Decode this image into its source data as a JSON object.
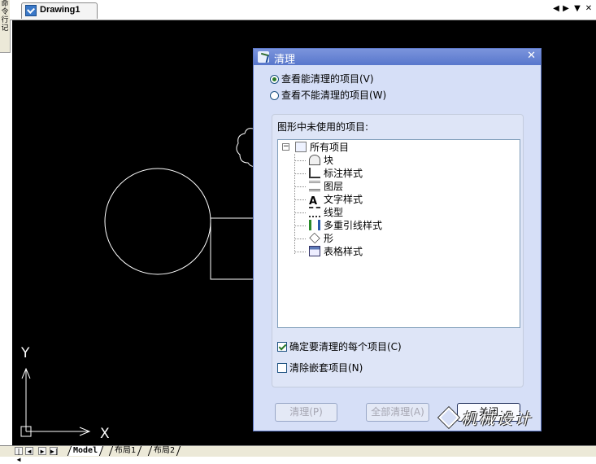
{
  "left_strip": {
    "chars": [
      "命",
      "令",
      "行",
      "记"
    ]
  },
  "tabbar": {
    "doc_tab_label": "Drawing1",
    "controls": [
      "◀",
      "▶",
      "▼",
      "✕"
    ]
  },
  "ucs": {
    "x_label": "X",
    "y_label": "Y"
  },
  "layout_tabs": {
    "nav": [
      "|◀",
      "◀",
      "▶",
      "▶|"
    ],
    "tabs": [
      "Model",
      "布局1",
      "布局2"
    ],
    "active": "Model"
  },
  "dialog": {
    "title": "清理",
    "close_glyph": "✕",
    "radio_view_purgeable": "查看能清理的项目(V)",
    "radio_view_unpurgeable": "查看不能清理的项目(W)",
    "selected_radio": "view_purgeable",
    "group_label": "图形中未使用的项目:",
    "tree_root": "所有项目",
    "tree_items": [
      "块",
      "标注样式",
      "图层",
      "文字样式",
      "线型",
      "多重引线样式",
      "形",
      "表格样式"
    ],
    "check_confirm": {
      "label": "确定要清理的每个项目(C)",
      "checked": true
    },
    "check_nested": {
      "label": "清除嵌套项目(N)",
      "checked": false
    },
    "btn_purge": "清理(P)",
    "btn_purge_all": "全部清理(A)",
    "btn_close": "关闭"
  },
  "watermark_text": "机械设计"
}
